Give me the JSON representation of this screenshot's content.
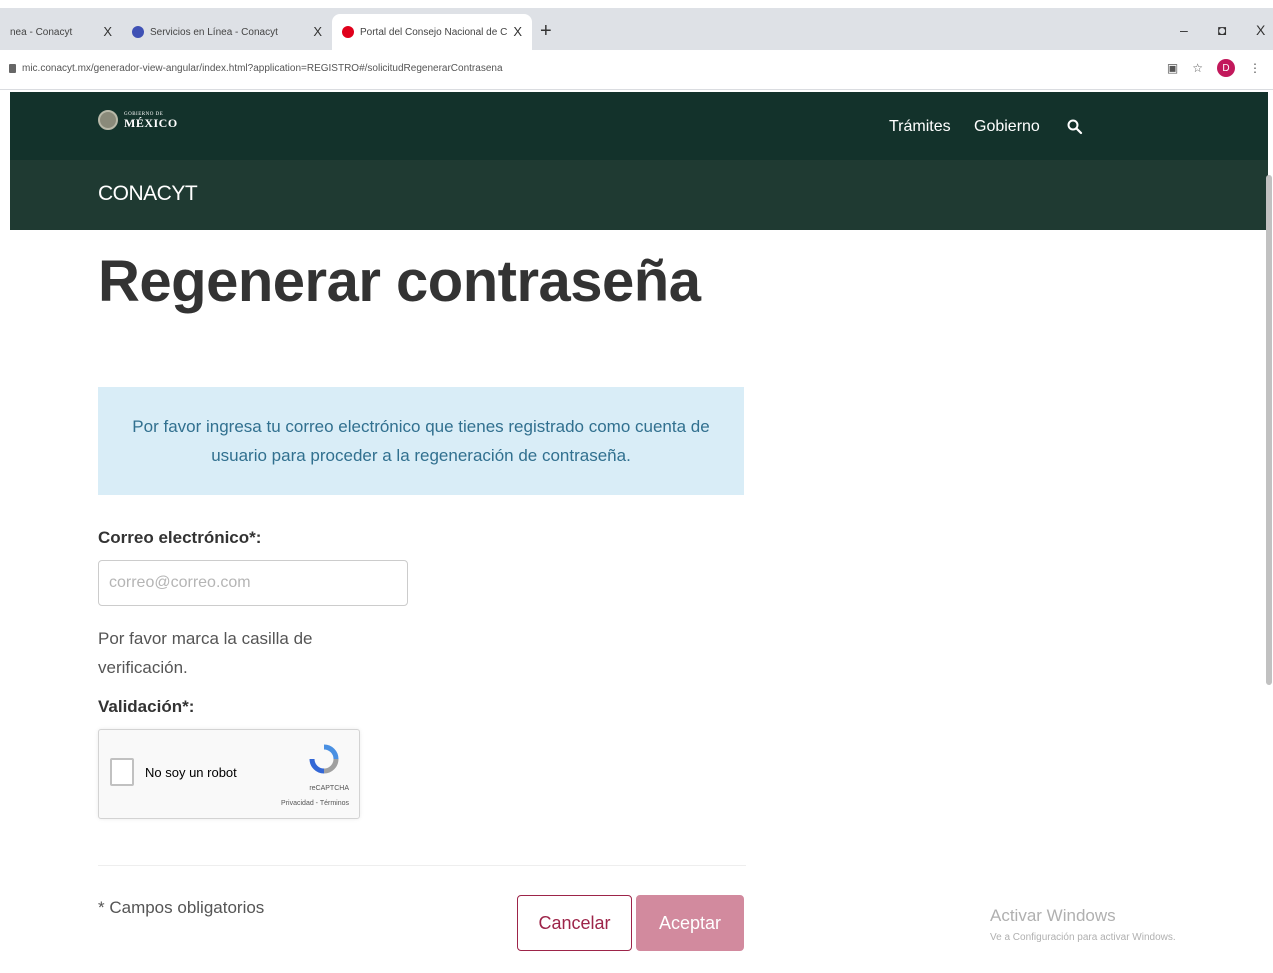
{
  "browser": {
    "tabs": [
      {
        "label": "nea - Conacyt",
        "close": "X"
      },
      {
        "label": "Servicios en Línea - Conacyt",
        "close": "X"
      },
      {
        "label": "Portal del Consejo Nacional de C",
        "close": "X"
      }
    ],
    "new_tab": "+",
    "window_controls": {
      "minimize": "–",
      "maximize": "◘",
      "close": "X"
    },
    "url": "mic.conacyt.mx/generador-view-angular/index.html?application=REGISTRO#/solicitudRegenerarContrasena",
    "profile_initial": "D"
  },
  "header": {
    "logo_small": "GOBIERNO DE",
    "logo_big": "MÉXICO",
    "nav": {
      "tramites": "Trámites",
      "gobierno": "Gobierno"
    },
    "section": "CONACYT"
  },
  "page": {
    "title": "Regenerar contraseña",
    "alert_text": "Por favor ingresa tu correo electrónico que tienes registrado como cuenta de usuario para proceder a la regeneración de contraseña.",
    "email_label": "Correo electrónico*:",
    "email_placeholder": "correo@correo.com",
    "email_value": "",
    "checkbox_help": "Por favor marca la casilla de verificación.",
    "validation_label": "Validación*:",
    "recaptcha": {
      "label": "No soy un robot",
      "brand": "reCAPTCHA",
      "terms": "Privacidad - Términos"
    },
    "required_note": "* Campos obligatorios",
    "cancel_label": "Cancelar",
    "accept_label": "Aceptar"
  },
  "watermark": {
    "line1": "Activar Windows",
    "line2": "Ve a Configuración para activar Windows."
  },
  "colors": {
    "header_dark": "#13322b",
    "header_sub": "#1f3a32",
    "alert_bg": "#d9edf7",
    "brand_primary": "#9d2449",
    "accept_button": "#d28a9e"
  }
}
